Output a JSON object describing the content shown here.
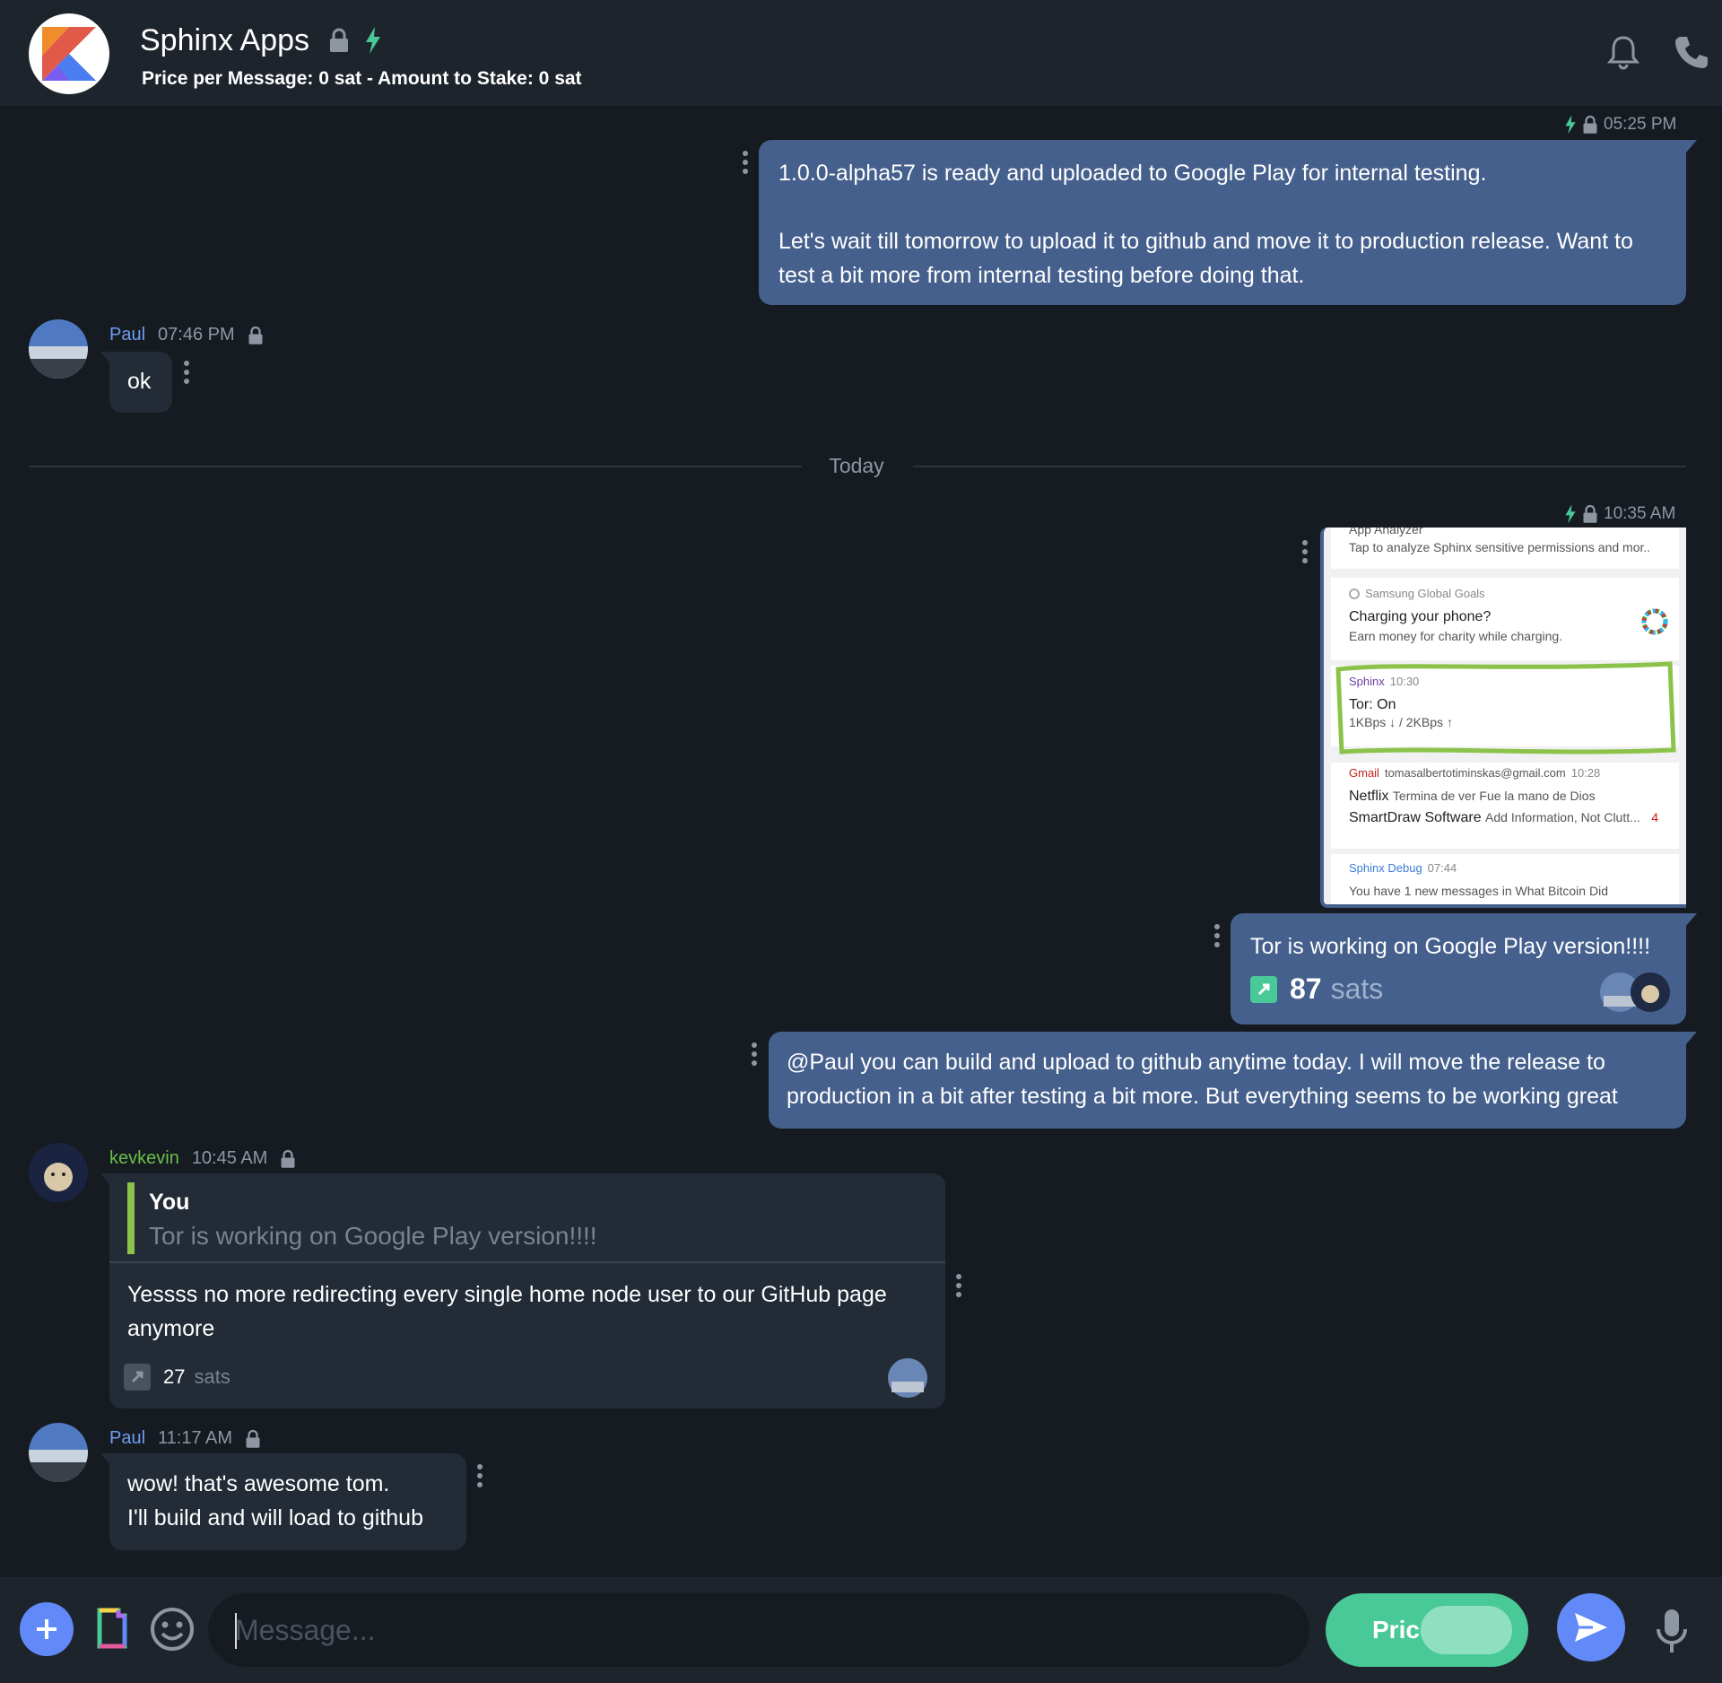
{
  "header": {
    "title": "Sphinx Apps",
    "subtitle": "Price per Message: 0 sat - Amount to Stake: 0 sat"
  },
  "messages": {
    "m1": {
      "time": "05:25 PM",
      "line1": "1.0.0-alpha57 is ready and uploaded to Google Play for internal testing.",
      "line2": "Let's wait till tomorrow to upload it to github and move it to production release. Want to test a bit more from internal testing before doing that."
    },
    "m2": {
      "sender": "Paul",
      "time": "07:46 PM",
      "text": "ok"
    },
    "divider": "Today",
    "m3": {
      "time": "10:35 AM",
      "screenshot": {
        "app_analyzer_title": "App Analyzer",
        "app_analyzer_sub": "Tap to analyze Sphinx sensitive permissions and mor..",
        "samsung_app": "Samsung Global Goals",
        "samsung_title": "Charging your phone?",
        "samsung_sub": "Earn money for charity while charging.",
        "sphinx_app": "Sphinx",
        "sphinx_time": "10:30",
        "sphinx_title": "Tor: On",
        "sphinx_sub": "1KBps ↓ / 2KBps ↑",
        "gmail_app": "Gmail",
        "gmail_account": "tomasalbertotiminskas@gmail.com",
        "gmail_time": "10:28",
        "netflix_sender": "Netflix",
        "netflix_text": "Termina de ver Fue la mano de Dios",
        "smartdraw_sender": "SmartDraw Software",
        "smartdraw_text": "Add Information, Not Clutt...",
        "smartdraw_count": "4",
        "debug_app": "Sphinx Debug",
        "debug_time": "07:44",
        "debug_text": "You have 1 new messages in What Bitcoin Did"
      }
    },
    "m4": {
      "text": "Tor is working on Google Play version!!!!",
      "boost_amount": "87",
      "boost_unit": "sats"
    },
    "m5": {
      "text": "@Paul you can build and upload to github anytime today. I will move the release to production in a bit after testing a bit more. But everything seems to be working great"
    },
    "m6": {
      "sender": "kevkevin",
      "time": "10:45 AM",
      "quote_author": "You",
      "quote_text": "Tor is working on Google Play version!!!!",
      "text": "Yessss no more redirecting every single home node user to our GitHub page anymore",
      "boost_amount": "27",
      "boost_unit": "sats"
    },
    "m7": {
      "sender": "Paul",
      "time": "11:17 AM",
      "line1": "wow! that's awesome tom.",
      "line2": "I'll build and will load to github"
    }
  },
  "footer": {
    "placeholder": "Message...",
    "price_label": "Price:"
  },
  "colors": {
    "background": "#161b22",
    "bar": "#1e242c",
    "outgoing_bubble": "#45608c",
    "incoming_bubble": "#232b36",
    "accent_blue": "#618af8",
    "price_green": "#49c998",
    "lightning_green": "#49c998",
    "paul_name": "#6e9ef0",
    "kevkevin_name": "#6abf4b"
  },
  "icons": [
    "lock-icon",
    "lightning-icon",
    "bell-icon",
    "phone-icon",
    "plus-icon",
    "gif-icon",
    "emoji-icon",
    "send-icon",
    "mic-icon",
    "boost-icon",
    "more-vertical-icon"
  ]
}
